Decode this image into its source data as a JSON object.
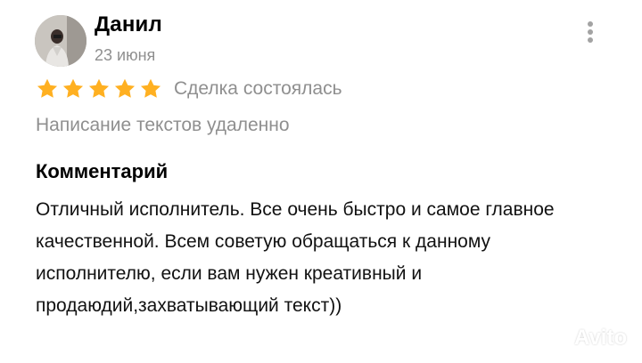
{
  "review": {
    "author_name": "Данил",
    "date": "23 июня",
    "rating": 5,
    "rating_max": 5,
    "deal_status": "Сделка состоялась",
    "service_title": "Написание текстов удаленно",
    "comment_heading": "Комментарий",
    "comment_text": "Отличный исполнитель. Все очень быстро и самое главное качественной. Всем советую обращаться к данному исполнителю, если вам нужен креативный и продаюдий,захватывающий текст))"
  },
  "watermark": {
    "text": "Avito"
  },
  "colors": {
    "star": "#FFB021",
    "secondary_text": "#8F8F8F",
    "menu_dots": "#A3A3A3"
  },
  "icons": {
    "menu": "more-vertical-icon",
    "star": "star-filled-icon",
    "watermark": "avito-logo-icon"
  }
}
